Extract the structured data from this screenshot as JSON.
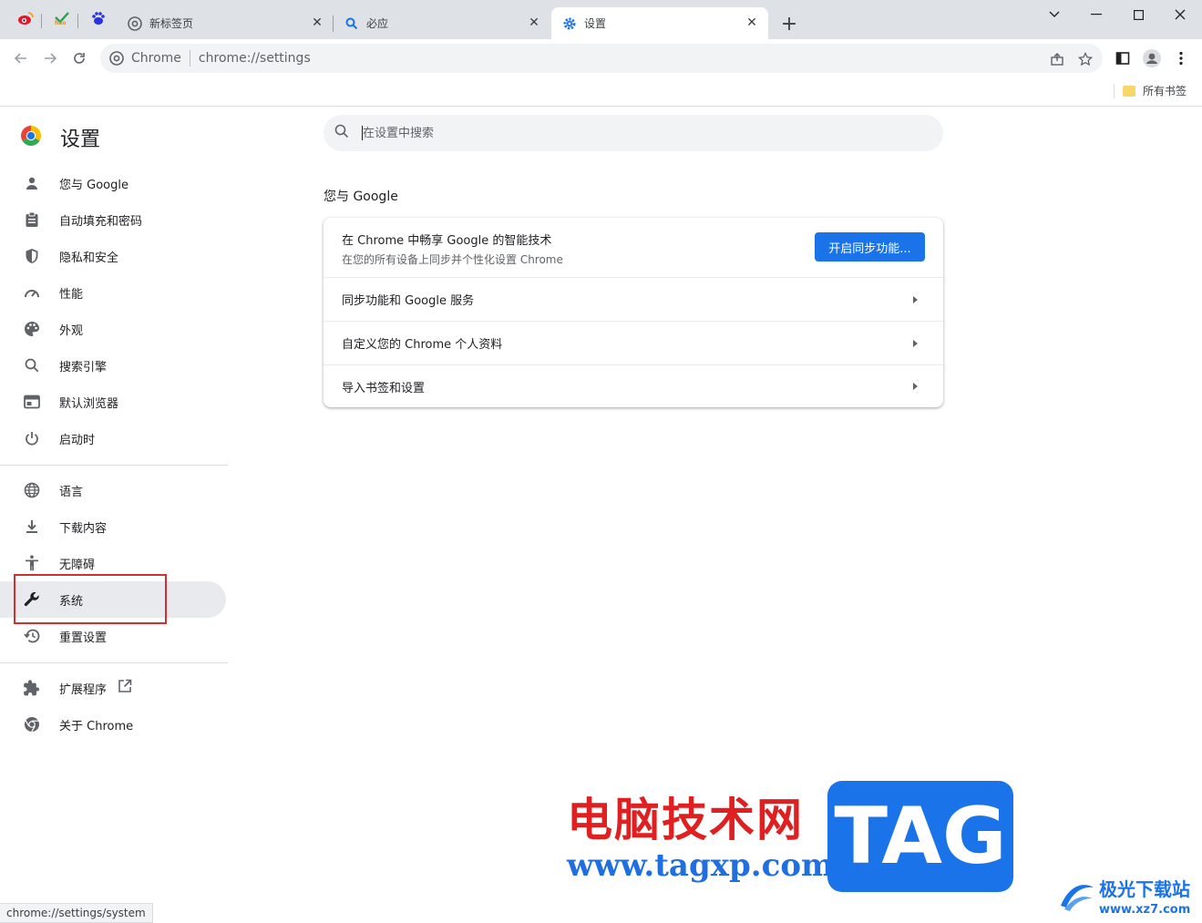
{
  "tabs": [
    {
      "icon": "weibo-icon",
      "title": ""
    },
    {
      "icon": "hao123-icon",
      "title": ""
    },
    {
      "icon": "baidu-icon",
      "title": ""
    },
    {
      "icon": "chrome-icon",
      "title": "新标签页"
    },
    {
      "icon": "search-icon",
      "title": "必应"
    },
    {
      "icon": "gear-icon",
      "title": "设置"
    }
  ],
  "omnibox": {
    "chip": "Chrome",
    "url": "chrome://settings"
  },
  "bookmarks": {
    "folder_label": "所有书签"
  },
  "settings": {
    "title": "设置",
    "search_placeholder": "在设置中搜索",
    "nav": [
      {
        "icon": "person-icon",
        "label": "您与 Google"
      },
      {
        "icon": "clipboard-icon",
        "label": "自动填充和密码"
      },
      {
        "icon": "shield-icon",
        "label": "隐私和安全"
      },
      {
        "icon": "speedometer-icon",
        "label": "性能"
      },
      {
        "icon": "palette-icon",
        "label": "外观"
      },
      {
        "icon": "search-icon",
        "label": "搜索引擎"
      },
      {
        "icon": "browser-icon",
        "label": "默认浏览器"
      },
      {
        "icon": "power-icon",
        "label": "启动时"
      },
      {
        "icon": "globe-icon",
        "label": "语言"
      },
      {
        "icon": "download-icon",
        "label": "下载内容"
      },
      {
        "icon": "accessibility-icon",
        "label": "无障碍"
      },
      {
        "icon": "wrench-icon",
        "label": "系统"
      },
      {
        "icon": "history-icon",
        "label": "重置设置"
      },
      {
        "icon": "puzzle-icon",
        "label": "扩展程序"
      },
      {
        "icon": "chrome-icon",
        "label": "关于 Chrome"
      }
    ],
    "selected_nav": "系统",
    "section_title": "您与 Google",
    "sync_card": {
      "title": "在 Chrome 中畅享 Google 的智能技术",
      "subtitle": "在您的所有设备上同步并个性化设置 Chrome",
      "button": "开启同步功能..."
    },
    "rows": [
      {
        "label": "同步功能和 Google 服务"
      },
      {
        "label": "自定义您的 Chrome 个人资料"
      },
      {
        "label": "导入书签和设置"
      }
    ]
  },
  "status_url": "chrome://settings/system",
  "watermarks": {
    "site_cn": "电脑技术网",
    "site_url": "www.tagxp.com",
    "tag": "TAG",
    "xz_cn": "极光下载站",
    "xz_url": "www.xz7.com"
  },
  "colors": {
    "accent": "#1a73e8",
    "highlight_box": "#d32f2f",
    "tabstrip": "#dee1e6"
  }
}
